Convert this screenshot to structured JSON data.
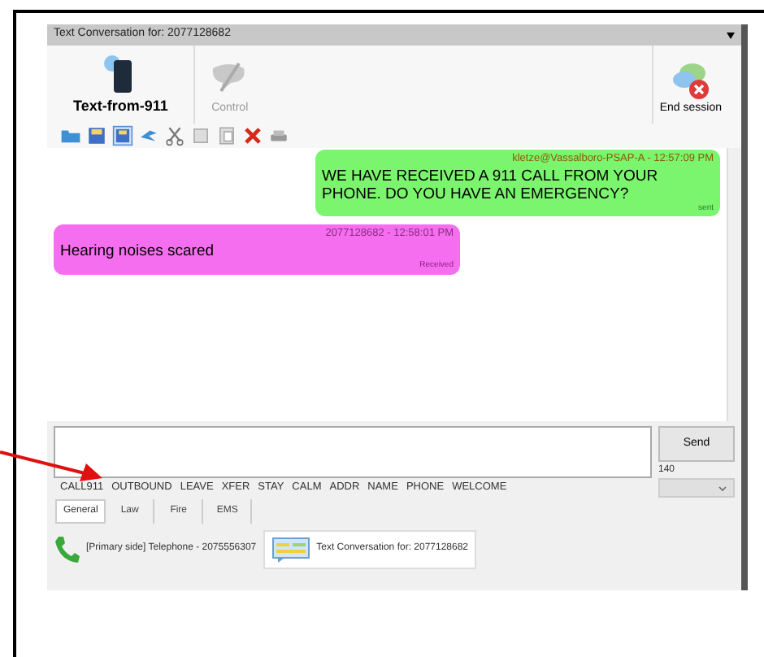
{
  "window": {
    "title": "Text Conversation for: 2077128682"
  },
  "toolbar": {
    "buttons": [
      {
        "label": "Text-from-911",
        "disabled": false
      },
      {
        "label": "Control",
        "disabled": true
      }
    ],
    "end_button": "End session"
  },
  "messages": [
    {
      "kind": "sent",
      "header": "kletze@Vassalboro-PSAP-A - 12:57:09 PM",
      "text": "WE HAVE RECEIVED A 911 CALL FROM YOUR PHONE. DO YOU HAVE AN EMERGENCY?",
      "status": "sent"
    },
    {
      "kind": "received",
      "header": "2077128682 - 12:58:01 PM",
      "text": "Hearing noises scared",
      "status": "Received"
    }
  ],
  "send_button": "Send",
  "char_count": "140",
  "quick_phrases": [
    "CALL911",
    "OUTBOUND",
    "LEAVE",
    "XFER",
    "STAY",
    "CALM",
    "ADDR",
    "NAME",
    "PHONE",
    "WELCOME"
  ],
  "tabs": [
    {
      "label": "General",
      "selected": true
    },
    {
      "label": "Law",
      "selected": false
    },
    {
      "label": "Fire",
      "selected": false
    },
    {
      "label": "EMS",
      "selected": false
    }
  ],
  "sessions": [
    {
      "kind": "phone",
      "label": "[Primary side] Telephone - 2075556307",
      "selected": false
    },
    {
      "kind": "text",
      "label": "Text Conversation for: 2077128682",
      "selected": true
    }
  ]
}
